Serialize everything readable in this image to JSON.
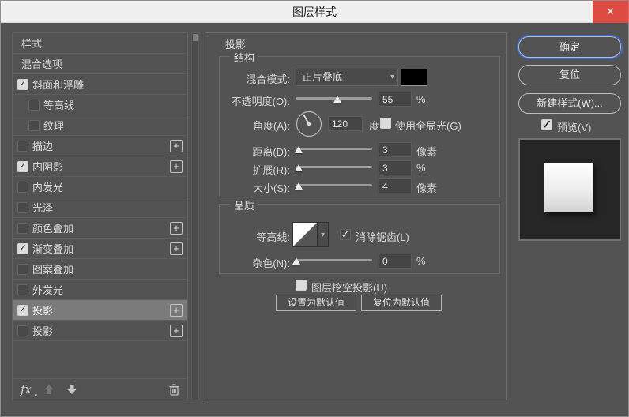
{
  "window": {
    "title": "图层样式"
  },
  "icons": {
    "close": "✕",
    "check": "✓",
    "plus": "+",
    "chevron_down": "▾",
    "caret_down": "▾"
  },
  "colors": {
    "titlebar_bg": "#f0f0f0",
    "close_red": "#dd4b42",
    "dialog_bg": "#535353",
    "selected_row": "#7a7a7a",
    "accent_blue": "#3b67c5",
    "swatch_color": "#000000",
    "preview_bg": "#262626"
  },
  "sidebar": {
    "items": [
      {
        "label": "样式",
        "checkbox": false
      },
      {
        "label": "混合选项",
        "checkbox": false
      },
      {
        "label": "斜面和浮雕",
        "checkbox": true,
        "checked": true
      },
      {
        "label": "等高线",
        "checkbox": true,
        "checked": false,
        "indent": true
      },
      {
        "label": "纹理",
        "checkbox": true,
        "checked": false,
        "indent": true
      },
      {
        "label": "描边",
        "checkbox": true,
        "checked": false,
        "plus": true
      },
      {
        "label": "内阴影",
        "checkbox": true,
        "checked": true,
        "plus": true
      },
      {
        "label": "内发光",
        "checkbox": true,
        "checked": false
      },
      {
        "label": "光泽",
        "checkbox": true,
        "checked": false
      },
      {
        "label": "颜色叠加",
        "checkbox": true,
        "checked": false,
        "plus": true
      },
      {
        "label": "渐变叠加",
        "checkbox": true,
        "checked": true,
        "plus": true
      },
      {
        "label": "图案叠加",
        "checkbox": true,
        "checked": false
      },
      {
        "label": "外发光",
        "checkbox": true,
        "checked": false
      },
      {
        "label": "投影",
        "checkbox": true,
        "checked": true,
        "plus": true,
        "selected": true
      },
      {
        "label": "投影",
        "checkbox": true,
        "checked": false,
        "plus": true
      }
    ],
    "toolbar": {
      "fx_label": "fx"
    }
  },
  "main": {
    "title": "投影",
    "structure_group": {
      "title": "结构",
      "blend_mode": {
        "label": "混合模式:",
        "value": "正片叠底"
      },
      "opacity": {
        "label": "不透明度(O):",
        "value": "55",
        "unit": "%",
        "slider_pct": 55
      },
      "angle": {
        "label": "角度(A):",
        "value": "120",
        "unit": "度",
        "use_global_label": "使用全局光(G)",
        "use_global_checked": true
      },
      "distance": {
        "label": "距离(D):",
        "value": "3",
        "unit": "像素",
        "slider_pct": 4
      },
      "spread": {
        "label": "扩展(R):",
        "value": "3",
        "unit": "%",
        "slider_pct": 4
      },
      "size": {
        "label": "大小(S):",
        "value": "4",
        "unit": "像素",
        "slider_pct": 4
      }
    },
    "quality_group": {
      "title": "品质",
      "contour": {
        "label": "等高线:",
        "anti_alias_label": "消除锯齿(L)",
        "anti_alias_checked": false
      },
      "noise": {
        "label": "杂色(N):",
        "value": "0",
        "unit": "%",
        "slider_pct": 1
      }
    },
    "knockout": {
      "label": "图层挖空投影(U)",
      "checked": true
    },
    "default_buttons": {
      "make_default": "设置为默认值",
      "reset_default": "复位为默认值"
    }
  },
  "right_panel": {
    "ok": "确定",
    "reset": "复位",
    "new_style": "新建样式(W)...",
    "preview_label": "预览(V)",
    "preview_checked": true
  }
}
